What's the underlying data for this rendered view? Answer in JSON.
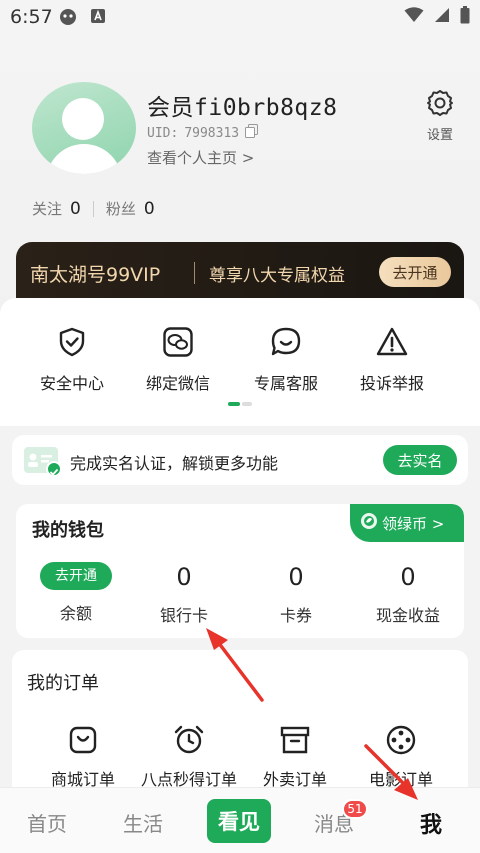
{
  "status_bar": {
    "time": "6:57"
  },
  "profile": {
    "username": "会员fi0brb8qz8",
    "uid_label": "UID:",
    "uid_value": "7998313",
    "view_home": "查看个人主页 >",
    "settings_label": "设置",
    "following_label": "关注",
    "following_count": "0",
    "followers_label": "粉丝",
    "followers_count": "0"
  },
  "vip": {
    "name": "南太湖号99VIP",
    "benefit": "尊享八大专属权益",
    "button": "去开通"
  },
  "services": [
    {
      "label": "安全中心",
      "icon": "shield-check-icon"
    },
    {
      "label": "绑定微信",
      "icon": "wechat-icon"
    },
    {
      "label": "专属客服",
      "icon": "chat-smile-icon"
    },
    {
      "label": "投诉举报",
      "icon": "warning-icon"
    }
  ],
  "realname": {
    "text": "完成实名认证，解锁更多功能",
    "button": "去实名"
  },
  "wallet": {
    "title": "我的钱包",
    "green_coin": "领绿币 >",
    "items": [
      {
        "value": "去开通",
        "label": "余额"
      },
      {
        "value": "0",
        "label": "银行卡"
      },
      {
        "value": "0",
        "label": "卡券"
      },
      {
        "value": "0",
        "label": "现金收益"
      }
    ]
  },
  "orders": {
    "title": "我的订单",
    "items": [
      {
        "label": "商城订单",
        "icon": "shopping-bag-icon"
      },
      {
        "label": "八点秒得订单",
        "icon": "alarm-clock-icon"
      },
      {
        "label": "外卖订单",
        "icon": "box-icon"
      },
      {
        "label": "电影订单",
        "icon": "film-reel-icon"
      }
    ]
  },
  "bottom_nav": {
    "home": "首页",
    "life": "生活",
    "center": "看见",
    "messages": "消息",
    "message_badge": "51",
    "me": "我"
  },
  "colors": {
    "accent": "#1faa59",
    "vip_bg": "#1f1a14",
    "vip_gold": "#f2d7ae",
    "badge": "#ef4b4b",
    "annotation_arrow": "#e8332a"
  }
}
